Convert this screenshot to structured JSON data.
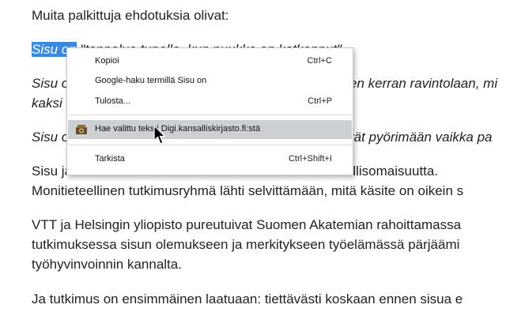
{
  "article": {
    "p1": "Muita palkittuja ehdotuksia olivat:",
    "p2_selected": "Sisu on",
    "p2_rest": " \"toppelue tupella, kun puukko on katkennut\".",
    "p3_line1_start": "Sisu o",
    "p3_line1_end": "en kerran ravintolaan, mi",
    "p3_line2": "kaksi",
    "p4_start": "Sisu o",
    "p4_end": "rät pyörimään vaikka pa",
    "p5_line1": "Sisu ja  eloukkaue ovat kaukkeinaa suomalaista kansallisomaisuutta.",
    "p5_line2": "Monitieteellinen tutkimusryhmä lähti selvittämään, mitä käsite on oikein s",
    "p6_line1": "VTT ja Helsingin yliopisto pureutuivat Suomen Akatemian rahoittamassa",
    "p6_line2": "tutkimuksessa sisun olemukseen ja merkitykseen työelämässä pärjäämi",
    "p6_line3": "työhyvinvoinnin kannalta.",
    "p7": "Ja tutkimus on ensimmäinen laatuaan: tiettävästi koskaan ennen sisua e"
  },
  "context_menu": {
    "items": [
      {
        "label": "Kopioi",
        "shortcut": "Ctrl+C"
      },
      {
        "label": "Google-haku termillä Sisu on",
        "shortcut": ""
      },
      {
        "label": "Tulosta...",
        "shortcut": "Ctrl+P"
      },
      {
        "label": "Hae valittu teksti Digi.kansalliskirjasto.fi:stä",
        "shortcut": ""
      },
      {
        "label": "Tarkista",
        "shortcut": "Ctrl+Shift+I"
      }
    ],
    "hovered_index": 3,
    "extension_icon": "digi-kansalliskirjasto-icon"
  },
  "colors": {
    "selection": "#3a8be0",
    "menu_hover": "#cdd0d3",
    "text": "#222222"
  }
}
